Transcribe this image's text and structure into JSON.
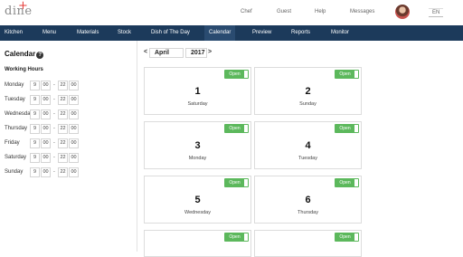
{
  "header": {
    "logo_text": "dine",
    "logo_mark": "+",
    "links": [
      "Chef",
      "Guest",
      "Help",
      "Messages"
    ],
    "language": "EN"
  },
  "nav": {
    "items": [
      "Kitchen",
      "Menu",
      "Materials",
      "Stock",
      "Dish of The Day",
      "Calendar",
      "Preview",
      "Reports",
      "Monitor"
    ],
    "active": "Calendar"
  },
  "sidebar": {
    "title": "Calendar",
    "help_icon": "?",
    "working_hours_title": "Working Hours",
    "days": [
      {
        "name": "Monday",
        "open_h": "9",
        "open_m": "00",
        "close_h": "22",
        "close_m": "00"
      },
      {
        "name": "Tuesday",
        "open_h": "9",
        "open_m": "00",
        "close_h": "22",
        "close_m": "00"
      },
      {
        "name": "Wednesday",
        "open_h": "9",
        "open_m": "00",
        "close_h": "22",
        "close_m": "00"
      },
      {
        "name": "Thursday",
        "open_h": "9",
        "open_m": "00",
        "close_h": "22",
        "close_m": "00"
      },
      {
        "name": "Friday",
        "open_h": "9",
        "open_m": "00",
        "close_h": "22",
        "close_m": "00"
      },
      {
        "name": "Saturday",
        "open_h": "9",
        "open_m": "00",
        "close_h": "22",
        "close_m": "00"
      },
      {
        "name": "Sunday",
        "open_h": "9",
        "open_m": "00",
        "close_h": "22",
        "close_m": "00"
      }
    ],
    "separator": "-"
  },
  "calendar": {
    "prev": "<",
    "next": ">",
    "month": "April",
    "year": "2017",
    "toggle_label": "Open",
    "days": [
      {
        "num": "1",
        "weekday": "Saturday"
      },
      {
        "num": "2",
        "weekday": "Sunday"
      },
      {
        "num": "3",
        "weekday": "Monday"
      },
      {
        "num": "4",
        "weekday": "Tuesday"
      },
      {
        "num": "5",
        "weekday": "Wednesday"
      },
      {
        "num": "6",
        "weekday": "Thursday"
      },
      {
        "num": "",
        "weekday": ""
      },
      {
        "num": "",
        "weekday": ""
      }
    ]
  },
  "colors": {
    "nav_bg": "#1c3a5b",
    "toggle_green": "#5cb85c",
    "logo_red": "#e53935"
  }
}
